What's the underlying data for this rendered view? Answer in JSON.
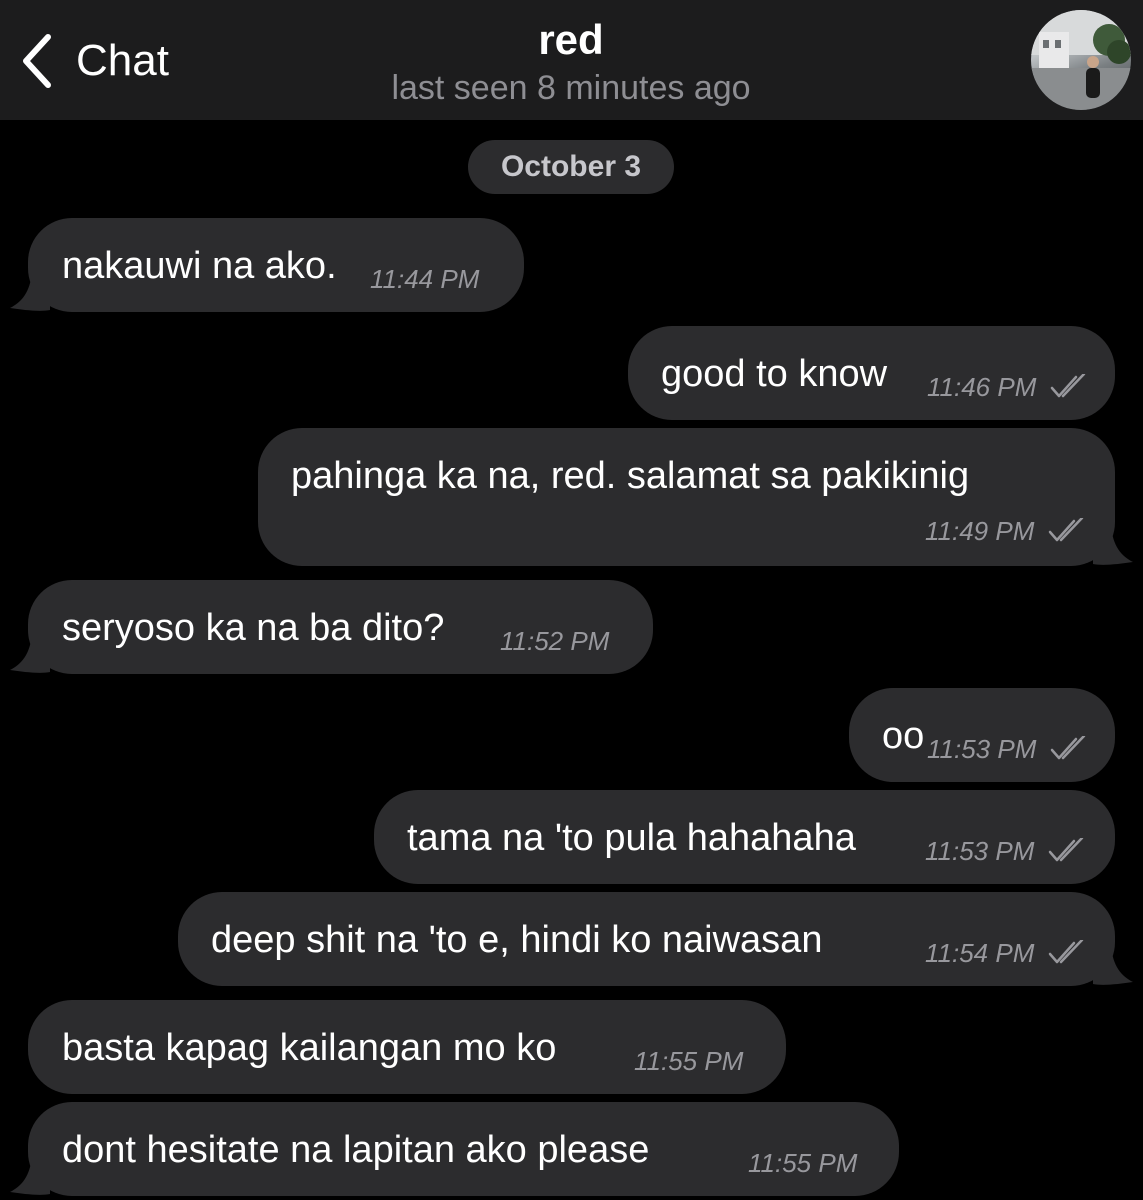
{
  "header": {
    "back_label": "Chat",
    "contact_name": "red",
    "status": "last seen 8 minutes ago"
  },
  "date_divider": "October 3",
  "messages": [
    {
      "direction": "incoming",
      "text": "nakauwi na ako.",
      "time": "11:44 PM"
    },
    {
      "direction": "outgoing",
      "text": "good to know",
      "time": "11:46 PM",
      "read": true
    },
    {
      "direction": "outgoing",
      "text": "pahinga ka na, red. salamat sa pakikinig",
      "time": "11:49 PM",
      "read": true
    },
    {
      "direction": "incoming",
      "text": "seryoso ka na ba dito?",
      "time": "11:52 PM"
    },
    {
      "direction": "outgoing",
      "text": "oo",
      "time": "11:53 PM",
      "read": true
    },
    {
      "direction": "outgoing",
      "text": "tama na 'to pula hahahaha",
      "time": "11:53 PM",
      "read": true
    },
    {
      "direction": "outgoing",
      "text": "deep shit na 'to e, hindi ko naiwasan",
      "time": "11:54 PM",
      "read": true
    },
    {
      "direction": "incoming",
      "text": "basta kapag kailangan mo ko",
      "time": "11:55 PM"
    },
    {
      "direction": "incoming",
      "text": "dont hesitate na lapitan ako please",
      "time": "11:55 PM"
    }
  ],
  "colors": {
    "background": "#000000",
    "header": "#1c1c1d",
    "bubble": "#2c2c2e",
    "secondary_text": "#8e8e93"
  },
  "icons": {
    "back": "chevron-left-icon",
    "read_receipt": "double-check-icon"
  }
}
